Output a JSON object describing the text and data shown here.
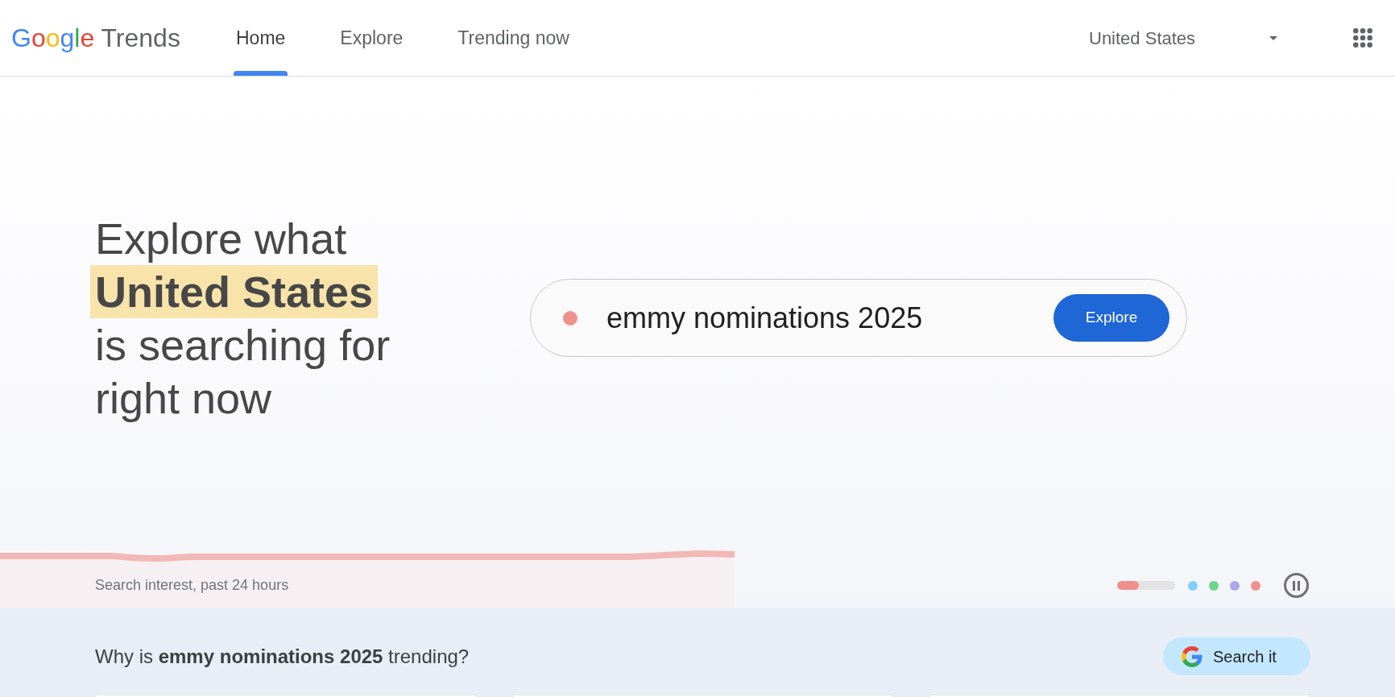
{
  "header": {
    "logo": {
      "brand": "Google",
      "product": "Trends"
    },
    "nav": [
      {
        "label": "Home",
        "selected": true
      },
      {
        "label": "Explore",
        "selected": false
      },
      {
        "label": "Trending now",
        "selected": false
      }
    ],
    "country": "United States"
  },
  "hero": {
    "headline": "Explore what **United States** is searching for right now",
    "trend": {
      "term": "emmy nominations 2025",
      "button": "Explore"
    },
    "chart": {
      "caption": "Search interest, past 24 hours"
    },
    "carousel": [
      {
        "selected": true,
        "level": 0.37,
        "color": "#ee918d"
      },
      {
        "selected": false,
        "color": "#80cfff"
      },
      {
        "selected": false,
        "color": "#6dd58c"
      },
      {
        "selected": false,
        "color": "#aba5ec"
      },
      {
        "selected": false,
        "color": "#ee918d"
      }
    ]
  },
  "explain": {
    "question": "Why is **emmy nominations 2025** trending?",
    "button": "Search it"
  }
}
